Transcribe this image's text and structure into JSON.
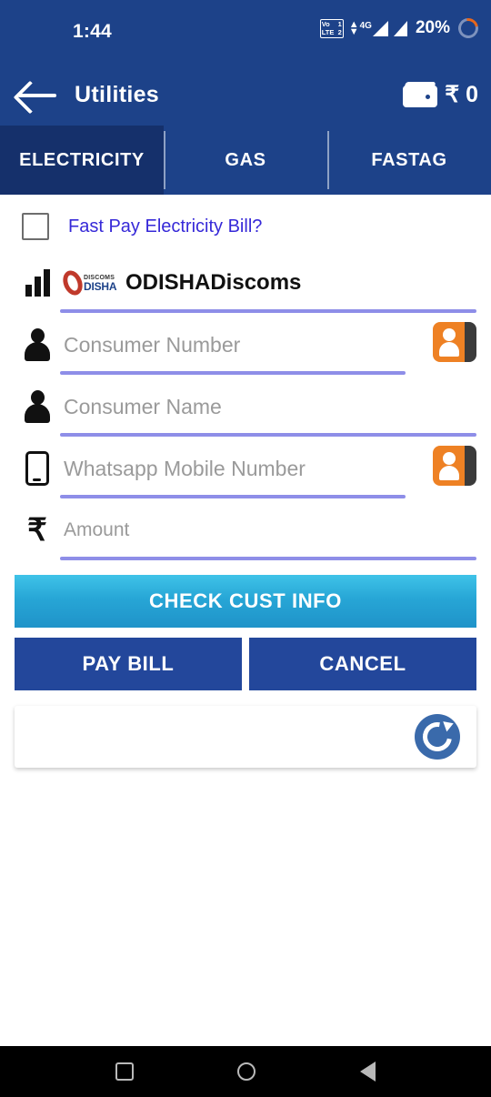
{
  "statusbar": {
    "time": "1:44",
    "volte_line1_left": "Vo",
    "volte_line1_right": "1",
    "volte_line2_left": "LTE",
    "volte_line2_right": "2",
    "network_type": "4G",
    "battery_percent": "20%",
    "updown_icon": "up-down-arrows-icon",
    "signal_icon": "signal-bars-icon",
    "battery_icon": "battery-ring-icon"
  },
  "appbar": {
    "back_icon": "back-arrow-icon",
    "title": "Utilities",
    "wallet_icon": "wallet-icon",
    "wallet_amount": "₹ 0"
  },
  "tabs": [
    {
      "label": "ELECTRICITY",
      "active": true
    },
    {
      "label": "GAS",
      "active": false
    },
    {
      "label": "FASTAG",
      "active": false
    }
  ],
  "form": {
    "fastpay": {
      "checkbox_name": "fast-pay-checkbox",
      "label": "Fast Pay Electricity Bill?",
      "checked": false
    },
    "operator": {
      "icon": "signal-bars-icon",
      "logo_top": "DISCOMS",
      "logo_bottom": "DISHA",
      "value": "ODISHADiscoms"
    },
    "fields": [
      {
        "name": "consumer-number",
        "icon": "person-icon",
        "placeholder": "Consumer Number",
        "value": "",
        "has_contact_picker": true
      },
      {
        "name": "consumer-name",
        "icon": "person-icon",
        "placeholder": "Consumer Name",
        "value": "",
        "has_contact_picker": false
      },
      {
        "name": "whatsapp-mobile-number",
        "icon": "phone-icon",
        "placeholder": "Whatsapp Mobile Number",
        "value": "",
        "has_contact_picker": true
      },
      {
        "name": "amount",
        "icon": "rupee-icon",
        "placeholder": "Amount",
        "value": "",
        "has_contact_picker": false
      }
    ]
  },
  "buttons": {
    "check_cust_info": "CHECK CUST INFO",
    "pay_bill": "PAY BILL",
    "cancel": "CANCEL"
  },
  "refresh_card": {
    "icon": "refresh-icon",
    "text": ""
  },
  "navbar": {
    "recents_icon": "square-recents-icon",
    "home_icon": "circle-home-icon",
    "back_icon": "triangle-back-icon"
  },
  "colors": {
    "header_blue": "#1d4289",
    "tab_active_blue": "#15306b",
    "link_blue": "#3629d8",
    "underline_purple": "#8e8ee8",
    "check_button_cyan": "#27a6d6",
    "action_button_blue": "#23479b",
    "contact_orange": "#ee8124",
    "refresh_blue": "#3a6aab"
  }
}
